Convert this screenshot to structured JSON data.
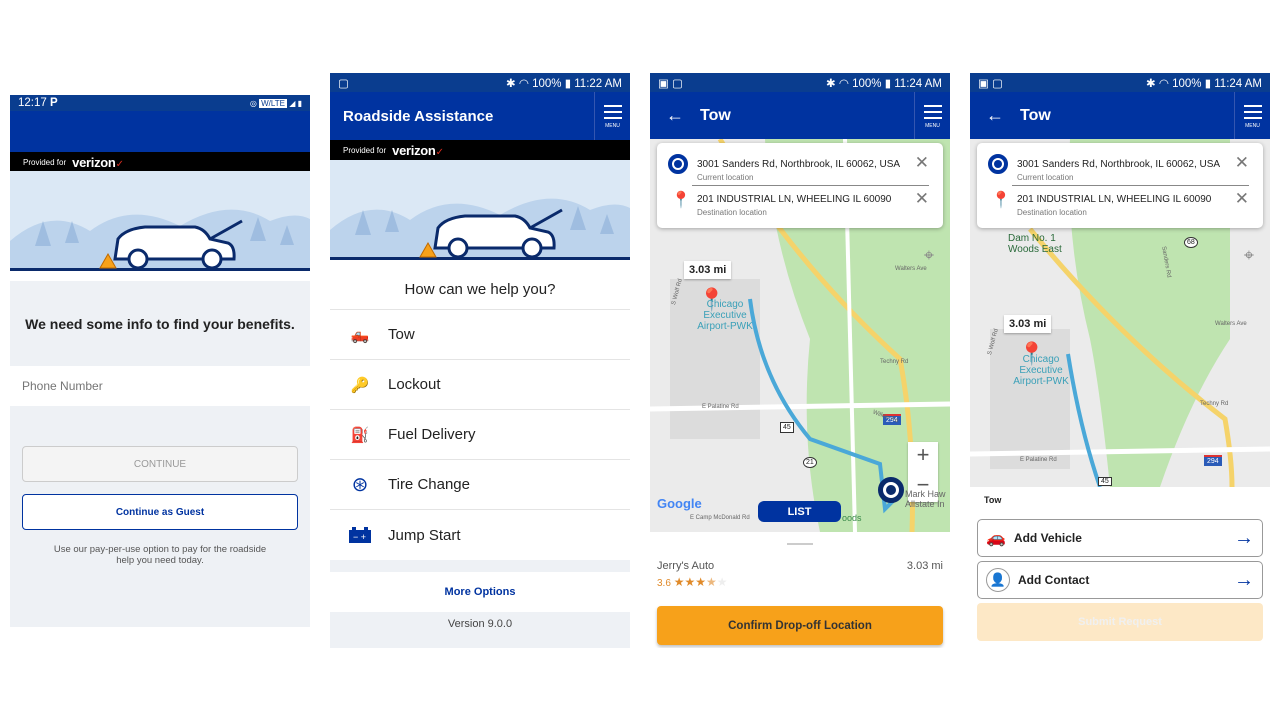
{
  "colors": {
    "brand_blue": "#0033a0",
    "status_blue": "#0a3d8f",
    "accent_orange": "#f7a11a",
    "route": "#4aa8d8",
    "verizon_red": "#d52b1e"
  },
  "provided_for": "Provided for",
  "brand": "verizon",
  "screen1": {
    "time": "12:17",
    "status_icons": [
      "p-icon",
      "nfc-icon",
      "wlte-icon",
      "signal-icon",
      "battery-icon"
    ],
    "lte": "W/LTE",
    "heading": "We need some info to find your benefits.",
    "phone_placeholder": "Phone Number",
    "continue": "CONTINUE",
    "guest": "Continue as Guest",
    "note": "Use our pay-per-use option to pay for the roadside help you need today."
  },
  "screen2": {
    "status": {
      "battery": "100%",
      "time": "11:22 AM"
    },
    "title": "Roadside Assistance",
    "menu": "MENU",
    "prompt": "How can we help you?",
    "services": [
      {
        "label": "Tow",
        "icon": "tow-truck-icon"
      },
      {
        "label": "Lockout",
        "icon": "key-icon"
      },
      {
        "label": "Fuel Delivery",
        "icon": "fuel-can-icon"
      },
      {
        "label": "Tire Change",
        "icon": "tire-icon"
      },
      {
        "label": "Jump Start",
        "icon": "battery-icon"
      }
    ],
    "more": "More Options",
    "version": "Version 9.0.0"
  },
  "screen3": {
    "status": {
      "battery": "100%",
      "time": "11:24 AM"
    },
    "title": "Tow",
    "menu": "MENU",
    "current": {
      "address": "3001 Sanders Rd, Northbrook, IL 60062, USA",
      "label": "Current location"
    },
    "destination": {
      "address": "201 INDUSTRIAL LN, WHEELING IL 60090",
      "label": "Destination location"
    },
    "map": {
      "distance": "3.03 mi",
      "airport": "Chicago Executive Airport-PWK",
      "roads": [
        "S Wolf Rd",
        "Walters Ave",
        "Techny Rd",
        "E Palatine Rd",
        "Willow Rd",
        "E Camp McDonald Rd"
      ],
      "shields": [
        "294",
        "45",
        "21"
      ],
      "poi": "Mark Haw Allstate In",
      "woods": "oods",
      "google": "Google",
      "list": "LIST",
      "zoom_in": "+",
      "zoom_out": "−"
    },
    "result": {
      "name": "Jerry's Auto",
      "rating": "3.6",
      "rating_value": 3.6,
      "distance": "3.03 mi"
    },
    "confirm": "Confirm Drop-off Location"
  },
  "screen4": {
    "status": {
      "battery": "100%",
      "time": "11:24 AM"
    },
    "title": "Tow",
    "menu": "MENU",
    "current": {
      "address": "3001 Sanders Rd, Northbrook, IL 60062, USA",
      "label": "Current location"
    },
    "destination": {
      "address": "201 INDUSTRIAL LN, WHEELING IL 60090",
      "label": "Destination location"
    },
    "map": {
      "distance": "3.03 mi",
      "dam": "Dam No. 1 Woods East",
      "airport": "Chicago Executive Airport-PWK",
      "shields": [
        "68",
        "294",
        "45"
      ],
      "roads": [
        "S Wolf Rd",
        "Walters Ave",
        "Techny Rd",
        "E Palatine Rd",
        "Sanders Rd"
      ]
    },
    "section": "Tow",
    "add_vehicle": "Add Vehicle",
    "add_contact": "Add Contact",
    "submit": "Submit Request"
  }
}
